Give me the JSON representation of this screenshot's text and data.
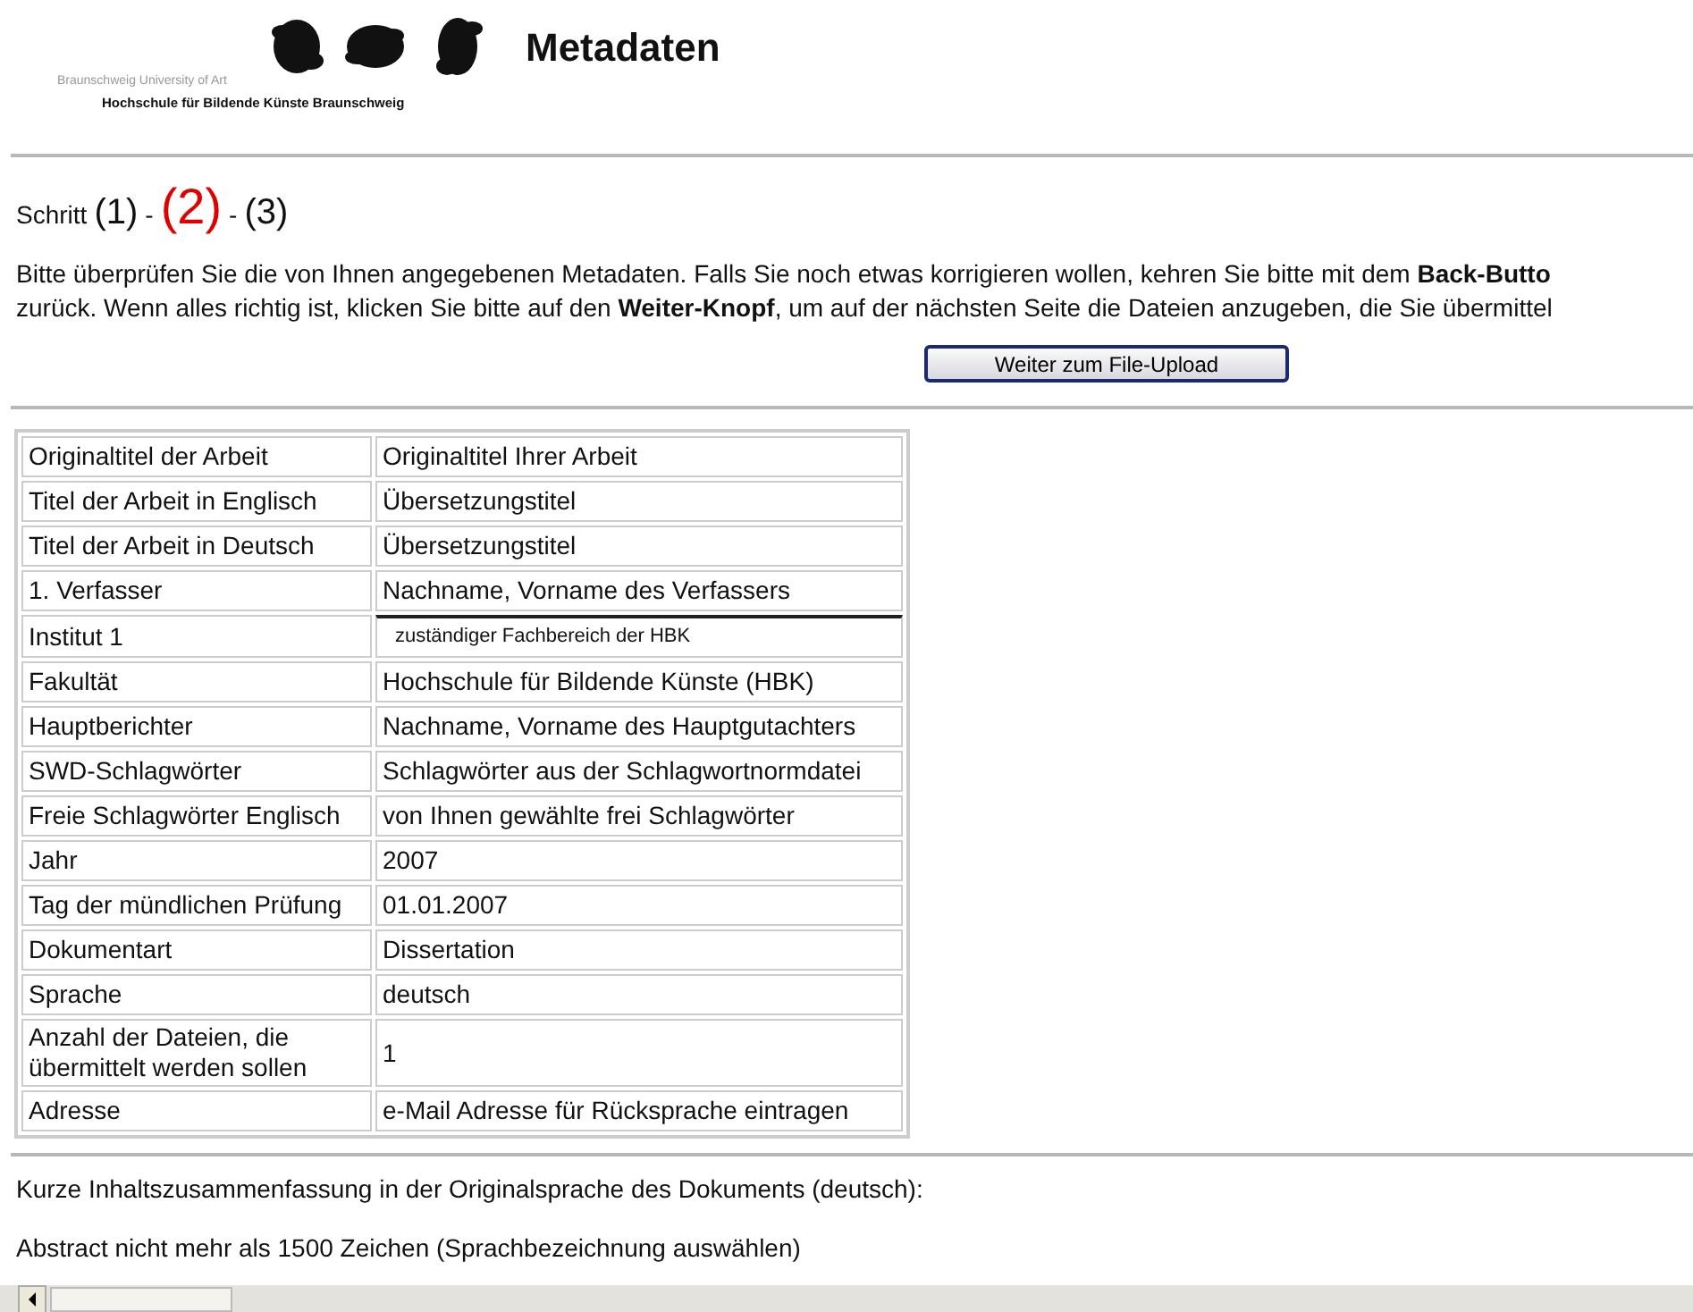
{
  "header": {
    "university_en": "Braunschweig University of Art",
    "university_de": "Hochschule für Bildende Künste Braunschweig",
    "title": "Metadaten"
  },
  "steps": {
    "label": "Schritt",
    "separator": "-",
    "items": [
      {
        "label": "(1)",
        "selected": false
      },
      {
        "label": "(2)",
        "selected": true
      },
      {
        "label": "(3)",
        "selected": false
      }
    ]
  },
  "intro_lines": [
    "Bitte überprüfen Sie die von Ihnen angegebenen Metadaten. Falls Sie noch etwas korrigieren wollen, kehren Sie bitte mit dem **Back-Butto**",
    "zurück. Wenn alles richtig ist, klicken Sie bitte auf den **Weiter-Knopf**, um auf der nächsten Seite die Dateien anzugeben, die Sie übermittel"
  ],
  "next_button": "Weiter zum File-Upload",
  "table": {
    "rows": [
      {
        "label": "Originaltitel der Arbeit",
        "value": "Originaltitel Ihrer Arbeit",
        "kind": "text"
      },
      {
        "label": "Titel der Arbeit in Englisch",
        "value": "Übersetzungstitel",
        "kind": "text"
      },
      {
        "label": "Titel der Arbeit in Deutsch",
        "value": "Übersetzungstitel",
        "kind": "text"
      },
      {
        "label": "1. Verfasser",
        "value": "Nachname, Vorname des Verfassers",
        "kind": "text"
      },
      {
        "label": "Institut 1",
        "value": "zuständiger Fachbereich der HBK",
        "kind": "select"
      },
      {
        "label": "Fakultät",
        "value": "Hochschule für Bildende Künste (HBK)",
        "kind": "text"
      },
      {
        "label": "Hauptberichter",
        "value": "Nachname, Vorname des Hauptgutachters",
        "kind": "text"
      },
      {
        "label": "SWD-Schlagwörter",
        "value": "Schlagwörter aus der Schlagwortnormdatei",
        "kind": "text"
      },
      {
        "label": "Freie Schlagwörter Englisch",
        "value": "von Ihnen gewählte frei Schlagwörter",
        "kind": "text"
      },
      {
        "label": "Jahr",
        "value": "2007",
        "kind": "text"
      },
      {
        "label": "Tag der mündlichen Prüfung",
        "value": "01.01.2007",
        "kind": "text"
      },
      {
        "label": "Dokumentart",
        "value": "Dissertation",
        "kind": "text"
      },
      {
        "label": "Sprache",
        "value": "deutsch",
        "kind": "text"
      },
      {
        "label": "Anzahl der Dateien, die übermittelt werden sollen",
        "value": "1",
        "kind": "text"
      },
      {
        "label": "Adresse",
        "value": "e-Mail Adresse für Rücksprache eintragen",
        "kind": "text"
      }
    ]
  },
  "summary_label": "Kurze Inhaltszusammenfassung in der Originalsprache des Dokuments (deutsch):",
  "abstract_hint": "Abstract nicht mehr als 1500 Zeichen (Sprachbezeichnung auswählen)"
}
